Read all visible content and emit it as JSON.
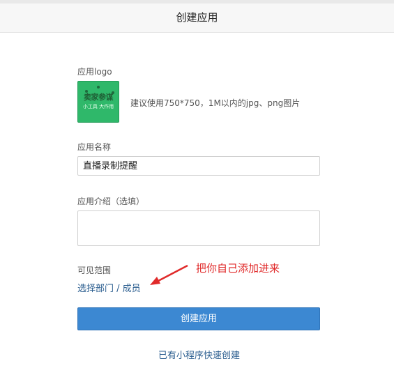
{
  "window": {
    "title": "创建应用"
  },
  "form": {
    "logo_label": "应用logo",
    "logo_title": "卖家参谋",
    "logo_subtitle": "小工具 大作用",
    "logo_hint": "建议使用750*750，1M以内的jpg、png图片",
    "name_label": "应用名称",
    "name_value": "直播录制提醒",
    "intro_label": "应用介绍（选填）",
    "intro_value": "",
    "scope_label": "可见范围",
    "scope_link": "选择部门 / 成员",
    "annotation": "把你自己添加进来",
    "submit_label": "创建应用",
    "miniprogram_link": "已有小程序快速创建"
  },
  "colors": {
    "accent": "#3c88d2",
    "link": "#2a5d8f",
    "annotation": "#e02a2a",
    "logo_bg": "#2fb86a"
  }
}
